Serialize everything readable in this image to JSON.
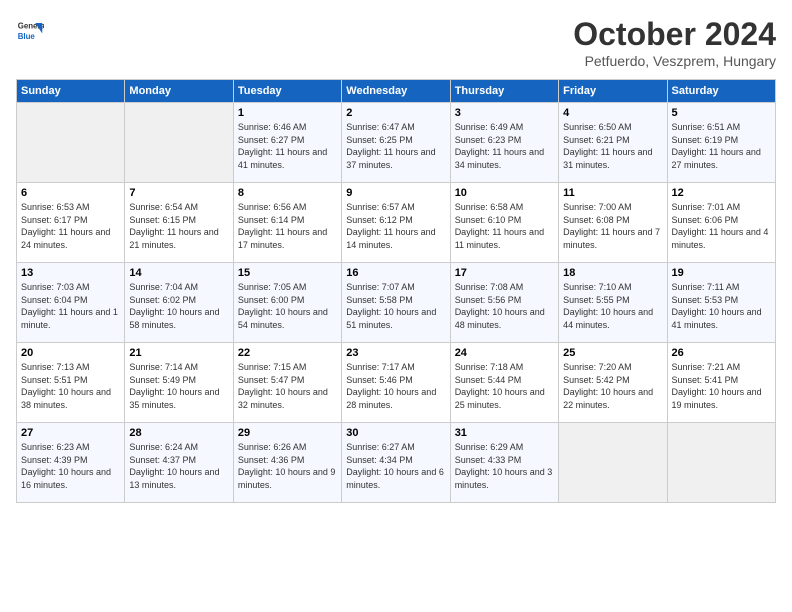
{
  "header": {
    "logo_general": "General",
    "logo_blue": "Blue",
    "month_title": "October 2024",
    "subtitle": "Petfuerdo, Veszprem, Hungary"
  },
  "days_of_week": [
    "Sunday",
    "Monday",
    "Tuesday",
    "Wednesday",
    "Thursday",
    "Friday",
    "Saturday"
  ],
  "weeks": [
    [
      {
        "day": "",
        "info": ""
      },
      {
        "day": "",
        "info": ""
      },
      {
        "day": "1",
        "info": "Sunrise: 6:46 AM\nSunset: 6:27 PM\nDaylight: 11 hours and 41 minutes."
      },
      {
        "day": "2",
        "info": "Sunrise: 6:47 AM\nSunset: 6:25 PM\nDaylight: 11 hours and 37 minutes."
      },
      {
        "day": "3",
        "info": "Sunrise: 6:49 AM\nSunset: 6:23 PM\nDaylight: 11 hours and 34 minutes."
      },
      {
        "day": "4",
        "info": "Sunrise: 6:50 AM\nSunset: 6:21 PM\nDaylight: 11 hours and 31 minutes."
      },
      {
        "day": "5",
        "info": "Sunrise: 6:51 AM\nSunset: 6:19 PM\nDaylight: 11 hours and 27 minutes."
      }
    ],
    [
      {
        "day": "6",
        "info": "Sunrise: 6:53 AM\nSunset: 6:17 PM\nDaylight: 11 hours and 24 minutes."
      },
      {
        "day": "7",
        "info": "Sunrise: 6:54 AM\nSunset: 6:15 PM\nDaylight: 11 hours and 21 minutes."
      },
      {
        "day": "8",
        "info": "Sunrise: 6:56 AM\nSunset: 6:14 PM\nDaylight: 11 hours and 17 minutes."
      },
      {
        "day": "9",
        "info": "Sunrise: 6:57 AM\nSunset: 6:12 PM\nDaylight: 11 hours and 14 minutes."
      },
      {
        "day": "10",
        "info": "Sunrise: 6:58 AM\nSunset: 6:10 PM\nDaylight: 11 hours and 11 minutes."
      },
      {
        "day": "11",
        "info": "Sunrise: 7:00 AM\nSunset: 6:08 PM\nDaylight: 11 hours and 7 minutes."
      },
      {
        "day": "12",
        "info": "Sunrise: 7:01 AM\nSunset: 6:06 PM\nDaylight: 11 hours and 4 minutes."
      }
    ],
    [
      {
        "day": "13",
        "info": "Sunrise: 7:03 AM\nSunset: 6:04 PM\nDaylight: 11 hours and 1 minute."
      },
      {
        "day": "14",
        "info": "Sunrise: 7:04 AM\nSunset: 6:02 PM\nDaylight: 10 hours and 58 minutes."
      },
      {
        "day": "15",
        "info": "Sunrise: 7:05 AM\nSunset: 6:00 PM\nDaylight: 10 hours and 54 minutes."
      },
      {
        "day": "16",
        "info": "Sunrise: 7:07 AM\nSunset: 5:58 PM\nDaylight: 10 hours and 51 minutes."
      },
      {
        "day": "17",
        "info": "Sunrise: 7:08 AM\nSunset: 5:56 PM\nDaylight: 10 hours and 48 minutes."
      },
      {
        "day": "18",
        "info": "Sunrise: 7:10 AM\nSunset: 5:55 PM\nDaylight: 10 hours and 44 minutes."
      },
      {
        "day": "19",
        "info": "Sunrise: 7:11 AM\nSunset: 5:53 PM\nDaylight: 10 hours and 41 minutes."
      }
    ],
    [
      {
        "day": "20",
        "info": "Sunrise: 7:13 AM\nSunset: 5:51 PM\nDaylight: 10 hours and 38 minutes."
      },
      {
        "day": "21",
        "info": "Sunrise: 7:14 AM\nSunset: 5:49 PM\nDaylight: 10 hours and 35 minutes."
      },
      {
        "day": "22",
        "info": "Sunrise: 7:15 AM\nSunset: 5:47 PM\nDaylight: 10 hours and 32 minutes."
      },
      {
        "day": "23",
        "info": "Sunrise: 7:17 AM\nSunset: 5:46 PM\nDaylight: 10 hours and 28 minutes."
      },
      {
        "day": "24",
        "info": "Sunrise: 7:18 AM\nSunset: 5:44 PM\nDaylight: 10 hours and 25 minutes."
      },
      {
        "day": "25",
        "info": "Sunrise: 7:20 AM\nSunset: 5:42 PM\nDaylight: 10 hours and 22 minutes."
      },
      {
        "day": "26",
        "info": "Sunrise: 7:21 AM\nSunset: 5:41 PM\nDaylight: 10 hours and 19 minutes."
      }
    ],
    [
      {
        "day": "27",
        "info": "Sunrise: 6:23 AM\nSunset: 4:39 PM\nDaylight: 10 hours and 16 minutes."
      },
      {
        "day": "28",
        "info": "Sunrise: 6:24 AM\nSunset: 4:37 PM\nDaylight: 10 hours and 13 minutes."
      },
      {
        "day": "29",
        "info": "Sunrise: 6:26 AM\nSunset: 4:36 PM\nDaylight: 10 hours and 9 minutes."
      },
      {
        "day": "30",
        "info": "Sunrise: 6:27 AM\nSunset: 4:34 PM\nDaylight: 10 hours and 6 minutes."
      },
      {
        "day": "31",
        "info": "Sunrise: 6:29 AM\nSunset: 4:33 PM\nDaylight: 10 hours and 3 minutes."
      },
      {
        "day": "",
        "info": ""
      },
      {
        "day": "",
        "info": ""
      }
    ]
  ]
}
